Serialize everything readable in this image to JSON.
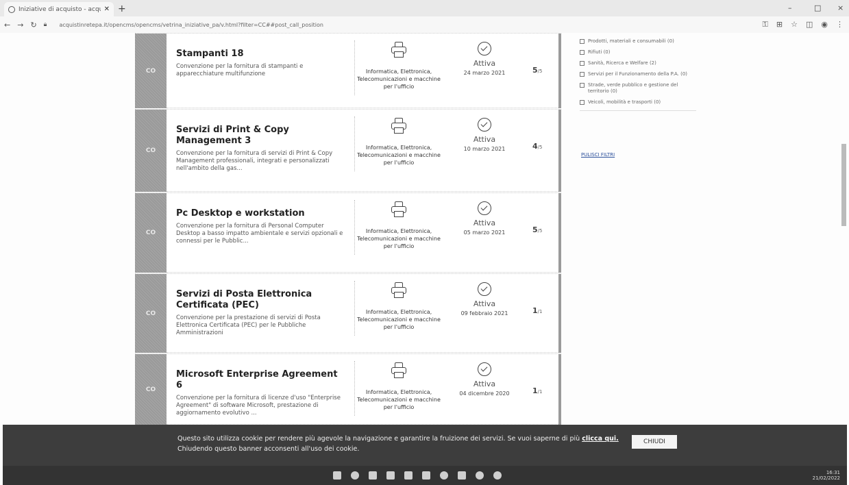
{
  "browser": {
    "tab_title": "Iniziative di acquisto - acquisti...",
    "new_tab": "+",
    "url": "acquistinretepa.it/opencms/opencms/vetrina_iniziative_pa/v.html?filter=CC##post_call_position",
    "win_min": "–",
    "win_max": "□",
    "win_close": "×"
  },
  "cards": [
    {
      "badge": "CO",
      "title": "Stampanti 18",
      "description": "Convenzione per la fornitura di stampanti e apparecchiature multifunzione",
      "category": "Informatica, Elettronica, Telecomunicazioni e macchine per l'ufficio",
      "status": "Attiva",
      "date": "24 marzo 2021",
      "rating": "5",
      "rating_den": "/5"
    },
    {
      "badge": "CO",
      "title": "Servizi di Print & Copy Management 3",
      "description": "Convenzione per la fornitura di servizi di Print & Copy Management professionali, integrati e personalizzati nell'ambito della gas...",
      "category": "Informatica, Elettronica, Telecomunicazioni e macchine per l'ufficio",
      "status": "Attiva",
      "date": "10 marzo 2021",
      "rating": "4",
      "rating_den": "/5"
    },
    {
      "badge": "CO",
      "title": "Pc Desktop e workstation",
      "description": "Convenzione per la fornitura di Personal Computer Desktop a basso impatto ambientale e servizi opzionali e connessi per le Pubblic...",
      "category": "Informatica, Elettronica, Telecomunicazioni e macchine per l'ufficio",
      "status": "Attiva",
      "date": "05 marzo 2021",
      "rating": "5",
      "rating_den": "/5"
    },
    {
      "badge": "CO",
      "title": "Servizi di Posta Elettronica Certificata (PEC)",
      "description": "Convenzione per la prestazione di servizi di Posta Elettronica Certificata (PEC) per le Pubbliche Amministrazioni",
      "category": "Informatica, Elettronica, Telecomunicazioni e macchine per l'ufficio",
      "status": "Attiva",
      "date": "09 febbraio 2021",
      "rating": "1",
      "rating_den": "/1"
    },
    {
      "badge": "CO",
      "title": "Microsoft Enterprise Agreement 6",
      "description": "Convenzione per la fornitura di licenze d'uso \"Enterprise Agreement\" di software Microsoft, prestazione di aggiornamento evolutivo ...",
      "category": "Informatica, Elettronica, Telecomunicazioni e macchine per l'ufficio",
      "status": "Attiva",
      "date": "04 dicembre 2020",
      "rating": "1",
      "rating_den": "/1"
    }
  ],
  "filters": [
    "Prodotti, materiali e consumabili (0)",
    "Rifiuti (0)",
    "Sanità, Ricerca e Welfare (2)",
    "Servizi per il Funzionamento della P.A. (0)",
    "Strade, verde pubblico e gestione del territorio (0)",
    "Veicoli, mobilità e trasporti (0)"
  ],
  "clear_filters": "PULISCI FILTRI",
  "cookie": {
    "text_1": "Questo sito utilizza cookie per rendere più agevole la navigazione e garantire la fruizione dei servizi. Se vuoi saperne di più",
    "link": "clicca qui.",
    "text_2": "Chiudendo questo banner acconsenti all'uso dei cookie.",
    "button": "CHIUDI"
  },
  "taskbar": {
    "time": "16:31",
    "date": "21/02/2022"
  }
}
